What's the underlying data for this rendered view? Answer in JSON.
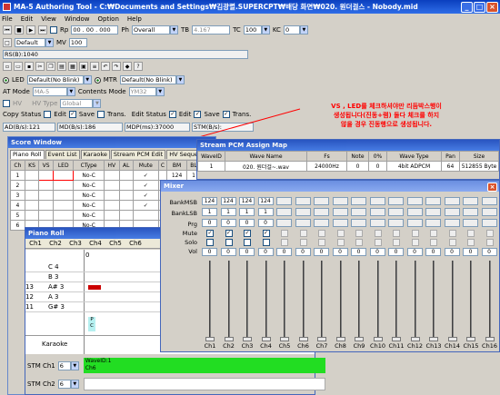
{
  "app": {
    "title": "MA-5 Authoring Tool - C:₩Documents and Settings₩김광렬.SUPERCPT₩배당 화면₩020. 원더걸스 - Nobody.mid"
  },
  "menu": [
    "File",
    "Edit",
    "View",
    "Window",
    "Option",
    "Help"
  ],
  "transport": {
    "rp_label": "Rp",
    "rp_value": "00 . 00 . 000",
    "ph_label": "Ph",
    "ph_value": "Overall",
    "tb_label": "TB",
    "tb_value": "4.167",
    "tc_label": "TC",
    "tc_value": "100",
    "kc_label": "KC",
    "kc_value": "0"
  },
  "mv_row": {
    "preset": "Default",
    "mv_label": "MV",
    "mv_value": "100"
  },
  "rs_text": "RS(B):1040",
  "led_row": {
    "led_label": "LED",
    "led_value": "Default(No Blink)",
    "mtr_label": "MTR",
    "mtr_value": "Default(No Blink)"
  },
  "at_row": {
    "at_label": "AT Mode",
    "at_value": "MA-5",
    "cm_label": "Contents Mode",
    "cm_value": "YM32"
  },
  "hv_row": {
    "hv_label": "HV",
    "hv_type_label": "HV Type",
    "hv_type_value": "Global"
  },
  "copy_row": {
    "copy_status": "Copy Status",
    "edit": "Edit",
    "save": "Save",
    "trans": "Trans.",
    "edit_status": "Edit Status"
  },
  "stats": {
    "ad": "AD(B/s):121",
    "md": "MD(B/s):186",
    "mdp": "MDP(ms):37000",
    "stm": "STM(B/s):"
  },
  "annotation": {
    "line1": "VS , LED를 체크하셔야만 리듬박스행이",
    "line2": "생성됩니다(진동+램) 둘다 체크를 하지",
    "line3": "않을 경우 진동행으로 생성됩니다."
  },
  "score": {
    "title": "Score Window",
    "tabs": [
      "Piano Roll",
      "Event List",
      "Karaoke",
      "Stream PCM Edit",
      "HV Seque"
    ],
    "headers": [
      "Ch",
      "KS",
      "VS",
      "LED",
      "CType",
      "HV",
      "AL",
      "Mute",
      "C",
      "BM",
      "BL"
    ],
    "rows": [
      {
        "ch": "1",
        "ctype": "No-C",
        "mute": "✓",
        "bm": "124",
        "bl": "1"
      },
      {
        "ch": "2",
        "ctype": "No-C",
        "mute": "✓",
        "bm": "",
        "bl": ""
      },
      {
        "ch": "3",
        "ctype": "No-C",
        "mute": "✓",
        "bm": "",
        "bl": ""
      },
      {
        "ch": "4",
        "ctype": "No-C",
        "mute": "✓",
        "bm": "",
        "bl": ""
      },
      {
        "ch": "5",
        "ctype": "No-C",
        "mute": "",
        "bm": "",
        "bl": ""
      },
      {
        "ch": "6",
        "ctype": "No-C",
        "mute": "",
        "bm": "",
        "bl": ""
      }
    ]
  },
  "piano": {
    "title": "Piano Roll",
    "cols": [
      "Ch1",
      "Ch2",
      "Ch3",
      "Ch4",
      "Ch5",
      "Ch6"
    ],
    "marker": "0",
    "rows": [
      {
        "num": "",
        "note": "C 4"
      },
      {
        "num": "",
        "note": "B 3"
      },
      {
        "num": "13",
        "note": "A# 3"
      },
      {
        "num": "12",
        "note": "A 3"
      },
      {
        "num": "11",
        "note": "G# 3"
      }
    ],
    "pc": "P\nC",
    "karaoke": "Karaoke",
    "stm1": "STM Ch1",
    "stm1_val": "6",
    "stm2": "STM Ch2",
    "stm2_val": "6",
    "wave_label1": "WaveID:1",
    "wave_label2": "Ch6"
  },
  "stream": {
    "title": "Stream PCM Assign Map",
    "headers": [
      "WaveID",
      "Wave Name",
      "Fs",
      "Note",
      "0%",
      "Wave Type",
      "Pan",
      "Size"
    ],
    "row": [
      "1",
      "020. 원더걸~.wav",
      "24000Hz",
      "0",
      "0",
      "4bit ADPCM",
      "64",
      "512855 Byte"
    ]
  },
  "mixer": {
    "title": "Mixer",
    "labels": [
      "BankMSB",
      "BankLSB",
      "Prg",
      "Mute",
      "Solo",
      "Vol"
    ],
    "bankmsb": [
      "124",
      "124",
      "124",
      "124"
    ],
    "banklsb": [
      "1",
      "1",
      "1",
      "1"
    ],
    "prg": [
      "0",
      "0",
      "0",
      "0"
    ],
    "vol": [
      "0",
      "0",
      "0",
      "0",
      "0",
      "0",
      "0",
      "0",
      "0",
      "0",
      "0",
      "0",
      "0",
      "0",
      "0",
      "0"
    ],
    "channels": [
      "Ch1",
      "Ch2",
      "Ch3",
      "Ch4",
      "Ch5",
      "Ch6",
      "Ch7",
      "Ch8",
      "Ch9",
      "Ch10",
      "Ch11",
      "Ch12",
      "Ch13",
      "Ch14",
      "Ch15",
      "Ch16"
    ]
  },
  "colors": {
    "title": "#1f55d6",
    "annotation": "#ff0000",
    "wave": "#22dd22"
  }
}
